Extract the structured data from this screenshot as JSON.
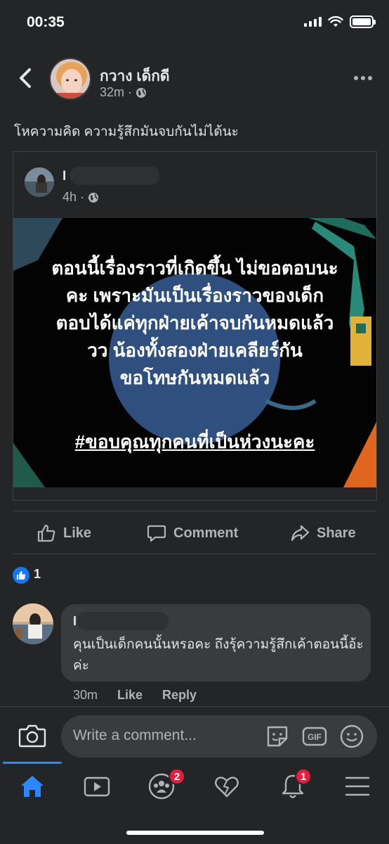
{
  "status_bar": {
    "time": "00:35"
  },
  "post": {
    "author": "กวาง เด็กดี",
    "time": "32m",
    "caption": "โหความคิด ความรู้สึกมันจบกันไม่ได้นะ"
  },
  "shared_post": {
    "author_initial": "I",
    "time": "4h",
    "image_text": [
      "ตอนนี้เรื่องราวที่เกิดขึ้น ไม่ขอตอบนะ",
      "คะ เพราะมันเป็นเรื่องราวของเด็ก",
      "ตอบได้แค่ทุกฝ่ายเค้าจบกันหมดแล้ว",
      "วว น้องทั้งสองฝ่ายเคลียร์กัน",
      "ขอโทษกันหมดแล้ว"
    ],
    "hashtag": "#ขอบคุณทุกคนที่เป็นห่วงนะคะ"
  },
  "actions": {
    "like": "Like",
    "comment": "Comment",
    "share": "Share"
  },
  "reactions": {
    "count": "1"
  },
  "comment": {
    "author_initial": "I",
    "text": "คุนเป็นเด็กคนนั้นหรอคะ  ถึงรุ้ความรู้สึกเค้าตอนนี้อ้ะค่ะ",
    "time": "30m",
    "like": "Like",
    "reply": "Reply"
  },
  "composer": {
    "placeholder": "Write a comment..."
  },
  "nav": {
    "groups_badge": "2",
    "notifications_badge": "1"
  },
  "colors": {
    "accent": "#2d88ff",
    "background": "#242526",
    "badge": "#e41e3f",
    "like_blue": "#1877f2"
  }
}
